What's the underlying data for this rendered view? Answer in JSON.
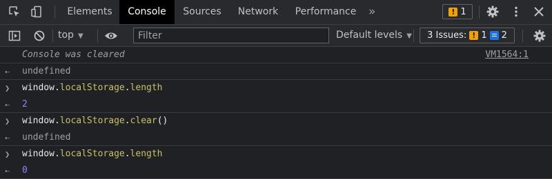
{
  "tabs": [
    "Elements",
    "Console",
    "Sources",
    "Network",
    "Performance"
  ],
  "more_tabs_glyph": "»",
  "header_issue_count": "1",
  "toolbar": {
    "context": "top",
    "filter_placeholder": "Filter",
    "levels": "Default levels",
    "issues_label": "3 Issues:",
    "issues_warning_count": "1",
    "issues_info_count": "2"
  },
  "console": {
    "cleared_text": "Console was cleared",
    "cleared_source": "VM1564:1",
    "entries": [
      {
        "kind": "result",
        "text": "undefined"
      },
      {
        "kind": "input",
        "object": "window",
        "dot1": ".",
        "property": "localStorage",
        "dot2": ".",
        "member": "length",
        "call": ""
      },
      {
        "kind": "result",
        "text": "2"
      },
      {
        "kind": "input",
        "object": "window",
        "dot1": ".",
        "property": "localStorage",
        "dot2": ".",
        "member": "clear",
        "call": "()"
      },
      {
        "kind": "result",
        "text": "undefined"
      },
      {
        "kind": "input",
        "object": "window",
        "dot1": ".",
        "property": "localStorage",
        "dot2": ".",
        "member": "length",
        "call": ""
      },
      {
        "kind": "result",
        "text": "0"
      }
    ]
  },
  "colors": {
    "background": "#202124",
    "toolbar": "#292a2d",
    "active_tab": "#000000",
    "number": "#9980ff",
    "property": "#c8c067",
    "warning": "#f2a100",
    "info": "#1a73e8"
  },
  "icons": [
    "inspect-element-icon",
    "device-toolbar-icon",
    "settings-gear-icon",
    "more-vertical-icon",
    "close-icon",
    "sidebar-toggle-icon",
    "clear-console-icon",
    "eye-icon",
    "chevron-right-icon",
    "return-arrow-icon",
    "warning-icon",
    "info-message-icon"
  ]
}
